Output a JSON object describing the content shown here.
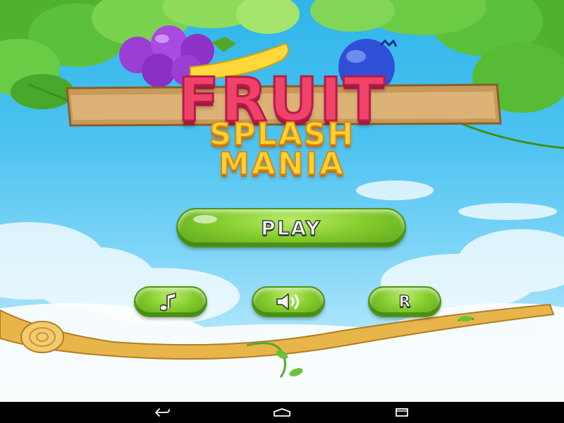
{
  "game": {
    "title_line1": "FRUIT",
    "title_line2": "SPLASH",
    "title_line3": "MANIA"
  },
  "menu": {
    "play_label": "PLAY",
    "music_icon": "music-note-icon",
    "sound_icon": "speaker-icon",
    "restart_label": "R"
  },
  "nav": {
    "back_icon": "back-icon",
    "home_icon": "home-icon",
    "recents_icon": "recents-icon"
  },
  "colors": {
    "sky": "#4cc3f0",
    "button_green": "#86cd2e",
    "title_pink": "#f0436a",
    "title_yellow": "#ffd22e",
    "branch": "#e8b54a"
  }
}
